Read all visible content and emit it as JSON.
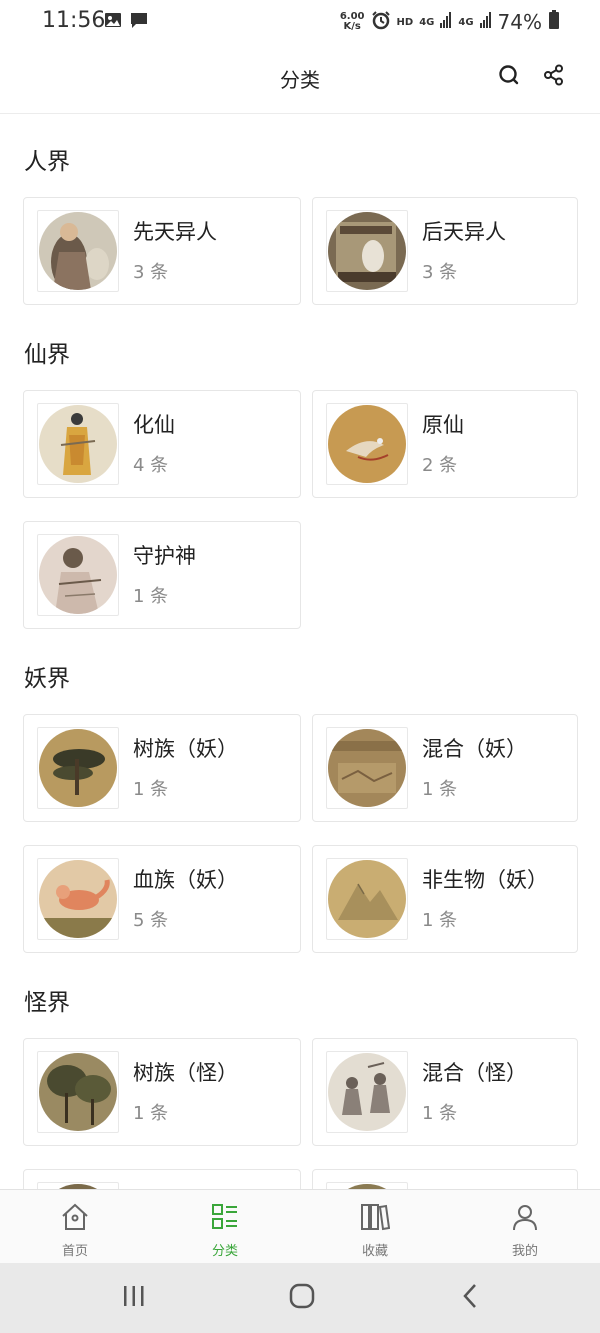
{
  "status_bar": {
    "time": "11:56",
    "net_speed_value": "6.00",
    "net_speed_unit": "K/s",
    "hd": "HD",
    "sig1": "4G",
    "sig2": "4G",
    "battery": "74%"
  },
  "header": {
    "title": "分类"
  },
  "sections": [
    {
      "title": "人界",
      "items": [
        {
          "name": "先天异人",
          "count": "3 条"
        },
        {
          "name": "后天异人",
          "count": "3 条"
        }
      ]
    },
    {
      "title": "仙界",
      "items": [
        {
          "name": "化仙",
          "count": "4 条"
        },
        {
          "name": "原仙",
          "count": "2 条"
        },
        {
          "name": "守护神",
          "count": "1 条"
        }
      ]
    },
    {
      "title": "妖界",
      "items": [
        {
          "name": "树族（妖）",
          "count": "1 条"
        },
        {
          "name": "混合（妖）",
          "count": "1 条"
        },
        {
          "name": "血族（妖）",
          "count": "5 条"
        },
        {
          "name": "非生物（妖）",
          "count": "1 条"
        }
      ]
    },
    {
      "title": "怪界",
      "items": [
        {
          "name": "树族（怪）",
          "count": "1 条"
        },
        {
          "name": "混合（怪）",
          "count": "1 条"
        }
      ]
    }
  ],
  "tabs": [
    {
      "label": "首页",
      "icon": "home-icon"
    },
    {
      "label": "分类",
      "icon": "category-icon",
      "active": true
    },
    {
      "label": "收藏",
      "icon": "bookshelf-icon"
    },
    {
      "label": "我的",
      "icon": "user-icon"
    }
  ],
  "colors": {
    "accent": "#3aa63a",
    "muted": "#8a8a8a"
  }
}
